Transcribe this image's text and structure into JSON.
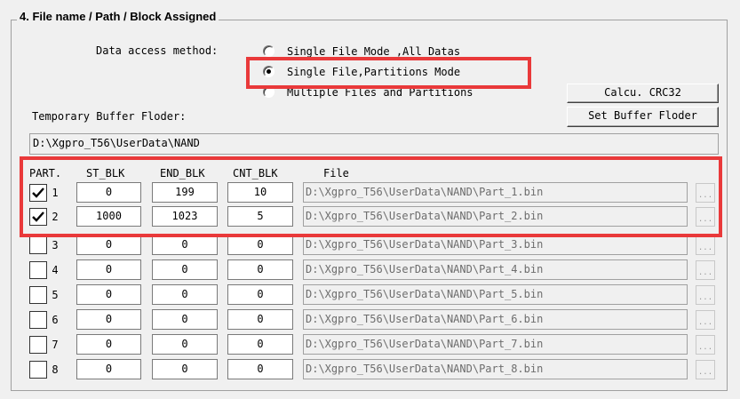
{
  "group_title": "4. File name / Path / Block Assigned",
  "access_method": {
    "label": "Data access method:",
    "options": [
      {
        "label": "Single File Mode ,All Datas",
        "selected": false
      },
      {
        "label": "Single File,Partitions Mode",
        "selected": true
      },
      {
        "label": "Multiple Files and Partitions",
        "selected": false
      }
    ]
  },
  "buttons": {
    "crc": "Calcu. CRC32",
    "set_buffer": "Set Buffer Floder"
  },
  "buffer": {
    "label": "Temporary Buffer Floder:",
    "path": "D:\\Xgpro_T56\\UserData\\NAND"
  },
  "table": {
    "headers": {
      "part": "PART.",
      "st": "ST_BLK",
      "end": "END_BLK",
      "cnt": "CNT_BLK",
      "file": "File"
    },
    "browse_label": "...",
    "rows": [
      {
        "num": "1",
        "checked": true,
        "st": "0",
        "end": "199",
        "cnt": "10",
        "file": "D:\\Xgpro_T56\\UserData\\NAND\\Part_1.bin"
      },
      {
        "num": "2",
        "checked": true,
        "st": "1000",
        "end": "1023",
        "cnt": "5",
        "file": "D:\\Xgpro_T56\\UserData\\NAND\\Part_2.bin"
      },
      {
        "num": "3",
        "checked": false,
        "st": "0",
        "end": "0",
        "cnt": "0",
        "file": "D:\\Xgpro_T56\\UserData\\NAND\\Part_3.bin"
      },
      {
        "num": "4",
        "checked": false,
        "st": "0",
        "end": "0",
        "cnt": "0",
        "file": "D:\\Xgpro_T56\\UserData\\NAND\\Part_4.bin"
      },
      {
        "num": "5",
        "checked": false,
        "st": "0",
        "end": "0",
        "cnt": "0",
        "file": "D:\\Xgpro_T56\\UserData\\NAND\\Part_5.bin"
      },
      {
        "num": "6",
        "checked": false,
        "st": "0",
        "end": "0",
        "cnt": "0",
        "file": "D:\\Xgpro_T56\\UserData\\NAND\\Part_6.bin"
      },
      {
        "num": "7",
        "checked": false,
        "st": "0",
        "end": "0",
        "cnt": "0",
        "file": "D:\\Xgpro_T56\\UserData\\NAND\\Part_7.bin"
      },
      {
        "num": "8",
        "checked": false,
        "st": "0",
        "end": "0",
        "cnt": "0",
        "file": "D:\\Xgpro_T56\\UserData\\NAND\\Part_8.bin"
      }
    ]
  },
  "colors": {
    "highlight": "#e9393a",
    "face": "#f0f0f0"
  }
}
